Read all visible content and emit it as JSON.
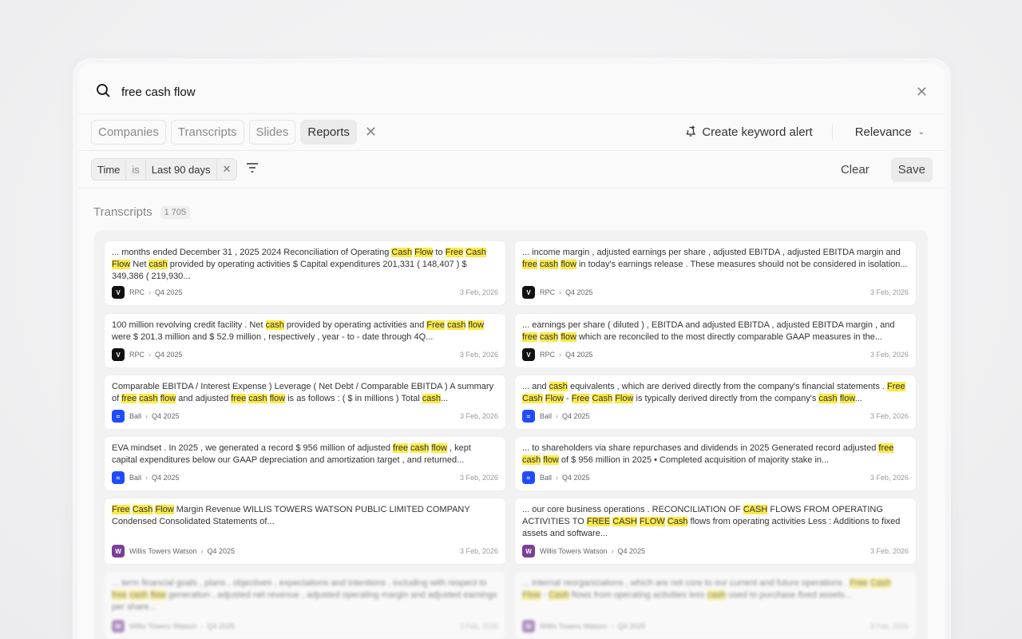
{
  "search": {
    "query": "free cash flow"
  },
  "tabs": [
    {
      "label": "Companies",
      "active": false
    },
    {
      "label": "Transcripts",
      "active": false
    },
    {
      "label": "Slides",
      "active": false
    },
    {
      "label": "Reports",
      "active": true
    }
  ],
  "toolbar": {
    "alert_label": "Create keyword alert",
    "sort_label": "Relevance"
  },
  "filter": {
    "field": "Time",
    "op": "is",
    "value": "Last 90 days"
  },
  "actions": {
    "clear": "Clear",
    "save": "Save"
  },
  "section": {
    "title": "Transcripts",
    "count": "1 705"
  },
  "colors": {
    "highlight": "#fbe94a",
    "rpc": "#111111",
    "ball": "#1f4cff",
    "wtw": "#7b3f98"
  },
  "results": [
    {
      "snippet": [
        {
          "t": "... months ended December 31 , 2025 2024 Reconciliation of Operating "
        },
        {
          "t": "Cash",
          "h": 1
        },
        {
          "t": " "
        },
        {
          "t": "Flow",
          "h": 1
        },
        {
          "t": " to "
        },
        {
          "t": "Free",
          "h": 1
        },
        {
          "t": " "
        },
        {
          "t": "Cash",
          "h": 1
        },
        {
          "t": " "
        },
        {
          "t": "Flow",
          "h": 1
        },
        {
          "t": " Net "
        },
        {
          "t": "cash",
          "h": 1
        },
        {
          "t": " provided by operating activities $ Capital expenditures 201,331 ( 148,407 ) $ 349,386 ( 219,930..."
        }
      ],
      "company": "RPC",
      "period": "Q4 2025",
      "date": "3 Feb, 2026",
      "logo": "rpc"
    },
    {
      "snippet": [
        {
          "t": "... income margin , adjusted earnings per share , adjusted EBITDA , adjusted EBITDA margin and "
        },
        {
          "t": "free",
          "h": 1
        },
        {
          "t": " "
        },
        {
          "t": "cash",
          "h": 1
        },
        {
          "t": " "
        },
        {
          "t": "flow",
          "h": 1
        },
        {
          "t": " in today's earnings release . These measures should not be considered in isolation..."
        }
      ],
      "company": "RPC",
      "period": "Q4 2025",
      "date": "3 Feb, 2026",
      "logo": "rpc"
    },
    {
      "snippet": [
        {
          "t": "100 million revolving credit facility . Net "
        },
        {
          "t": "cash",
          "h": 1
        },
        {
          "t": " provided by operating activities and "
        },
        {
          "t": "Free",
          "h": 1
        },
        {
          "t": " "
        },
        {
          "t": "cash",
          "h": 1
        },
        {
          "t": " "
        },
        {
          "t": "flow",
          "h": 1
        },
        {
          "t": " were $ 201.3 million and $ 52.9 million , respectively , year - to - date through 4Q..."
        }
      ],
      "company": "RPC",
      "period": "Q4 2025",
      "date": "3 Feb, 2026",
      "logo": "rpc"
    },
    {
      "snippet": [
        {
          "t": "... earnings per share ( diluted ) , EBITDA and adjusted EBITDA , adjusted EBITDA margin , and "
        },
        {
          "t": "free",
          "h": 1
        },
        {
          "t": " "
        },
        {
          "t": "cash",
          "h": 1
        },
        {
          "t": " "
        },
        {
          "t": "flow",
          "h": 1
        },
        {
          "t": " which are reconciled to the most directly comparable GAAP measures in the..."
        }
      ],
      "company": "RPC",
      "period": "Q4 2025",
      "date": "3 Feb, 2026",
      "logo": "rpc"
    },
    {
      "snippet": [
        {
          "t": "Comparable EBITDA / Interest Expense ) Leverage ( Net Debt / Comparable EBITDA ) A summary of "
        },
        {
          "t": "free",
          "h": 1
        },
        {
          "t": " "
        },
        {
          "t": "cash",
          "h": 1
        },
        {
          "t": " "
        },
        {
          "t": "flow",
          "h": 1
        },
        {
          "t": " and adjusted "
        },
        {
          "t": "free",
          "h": 1
        },
        {
          "t": " "
        },
        {
          "t": "cash",
          "h": 1
        },
        {
          "t": " "
        },
        {
          "t": "flow",
          "h": 1
        },
        {
          "t": " is as follows : ( $ in millions ) Total "
        },
        {
          "t": "cash",
          "h": 1
        },
        {
          "t": "..."
        }
      ],
      "company": "Ball",
      "period": "Q4 2025",
      "date": "3 Feb, 2026",
      "logo": "ball"
    },
    {
      "snippet": [
        {
          "t": "... and "
        },
        {
          "t": "cash",
          "h": 1
        },
        {
          "t": " equivalents , which are derived directly from the company's financial statements . "
        },
        {
          "t": "Free",
          "h": 1
        },
        {
          "t": " "
        },
        {
          "t": "Cash",
          "h": 1
        },
        {
          "t": " "
        },
        {
          "t": "Flow",
          "h": 1
        },
        {
          "t": " - "
        },
        {
          "t": "Free",
          "h": 1
        },
        {
          "t": " "
        },
        {
          "t": "Cash",
          "h": 1
        },
        {
          "t": " "
        },
        {
          "t": "Flow",
          "h": 1
        },
        {
          "t": " is typically derived directly from the company's "
        },
        {
          "t": "cash",
          "h": 1
        },
        {
          "t": " "
        },
        {
          "t": "flow",
          "h": 1
        },
        {
          "t": "..."
        }
      ],
      "company": "Ball",
      "period": "Q4 2025",
      "date": "3 Feb, 2026",
      "logo": "ball"
    },
    {
      "snippet": [
        {
          "t": "EVA mindset . In 2025 , we generated a record $ 956 million of adjusted "
        },
        {
          "t": "free",
          "h": 1
        },
        {
          "t": " "
        },
        {
          "t": "cash",
          "h": 1
        },
        {
          "t": " "
        },
        {
          "t": "flow",
          "h": 1
        },
        {
          "t": " , kept capital expenditures below our GAAP depreciation and amortization target , and returned..."
        }
      ],
      "company": "Ball",
      "period": "Q4 2025",
      "date": "3 Feb, 2026",
      "logo": "ball"
    },
    {
      "snippet": [
        {
          "t": "... to shareholders via share repurchases and dividends in 2025 Generated record adjusted "
        },
        {
          "t": "free",
          "h": 1
        },
        {
          "t": " "
        },
        {
          "t": "cash",
          "h": 1
        },
        {
          "t": " "
        },
        {
          "t": "flow",
          "h": 1
        },
        {
          "t": " of $ 956 million in 2025 • Completed acquisition of majority stake in..."
        }
      ],
      "company": "Ball",
      "period": "Q4 2025",
      "date": "3 Feb, 2026",
      "logo": "ball"
    },
    {
      "snippet": [
        {
          "t": "Free",
          "h": 1
        },
        {
          "t": " "
        },
        {
          "t": "Cash",
          "h": 1
        },
        {
          "t": " "
        },
        {
          "t": "Flow",
          "h": 1
        },
        {
          "t": " Margin Revenue WILLIS TOWERS WATSON PUBLIC LIMITED COMPANY Condensed Consolidated Statements of..."
        }
      ],
      "company": "Willis Towers Watson",
      "period": "Q4 2025",
      "date": "3 Feb, 2026",
      "logo": "wtw"
    },
    {
      "snippet": [
        {
          "t": "... our core business operations . RECONCILIATION OF "
        },
        {
          "t": "CASH",
          "h": 1
        },
        {
          "t": " FLOWS FROM OPERATING ACTIVITIES TO "
        },
        {
          "t": "FREE",
          "h": 1
        },
        {
          "t": " "
        },
        {
          "t": "CASH",
          "h": 1
        },
        {
          "t": " "
        },
        {
          "t": "FLOW",
          "h": 1
        },
        {
          "t": " "
        },
        {
          "t": "Cash",
          "h": 1
        },
        {
          "t": " flows from operating activities Less : Additions to fixed assets and software..."
        }
      ],
      "company": "Willis Towers Watson",
      "period": "Q4 2025",
      "date": "3 Feb, 2026",
      "logo": "wtw"
    },
    {
      "snippet": [
        {
          "t": "... term financial goals , plans , objectives , expectations and intentions , including with respect to "
        },
        {
          "t": "free",
          "h": 1
        },
        {
          "t": " "
        },
        {
          "t": "cash",
          "h": 1
        },
        {
          "t": " "
        },
        {
          "t": "flow",
          "h": 1
        },
        {
          "t": " generation , adjusted net revenue , adjusted operating margin and adjusted earnings per share..."
        }
      ],
      "company": "Willis Towers Watson",
      "period": "Q4 2025",
      "date": "3 Feb, 2026",
      "logo": "wtw",
      "blurred": true
    },
    {
      "snippet": [
        {
          "t": "... internal reorganizations , which are not core to our current and future operations . "
        },
        {
          "t": "Free",
          "h": 1
        },
        {
          "t": " "
        },
        {
          "t": "Cash",
          "h": 1
        },
        {
          "t": " "
        },
        {
          "t": "Flow",
          "h": 1
        },
        {
          "t": " - "
        },
        {
          "t": "Cash",
          "h": 1
        },
        {
          "t": " flows from operating activities less "
        },
        {
          "t": "cash",
          "h": 1
        },
        {
          "t": " used to purchase fixed assets..."
        }
      ],
      "company": "Willis Towers Watson",
      "period": "Q4 2025",
      "date": "3 Feb, 2026",
      "logo": "wtw",
      "blurred": true
    }
  ]
}
